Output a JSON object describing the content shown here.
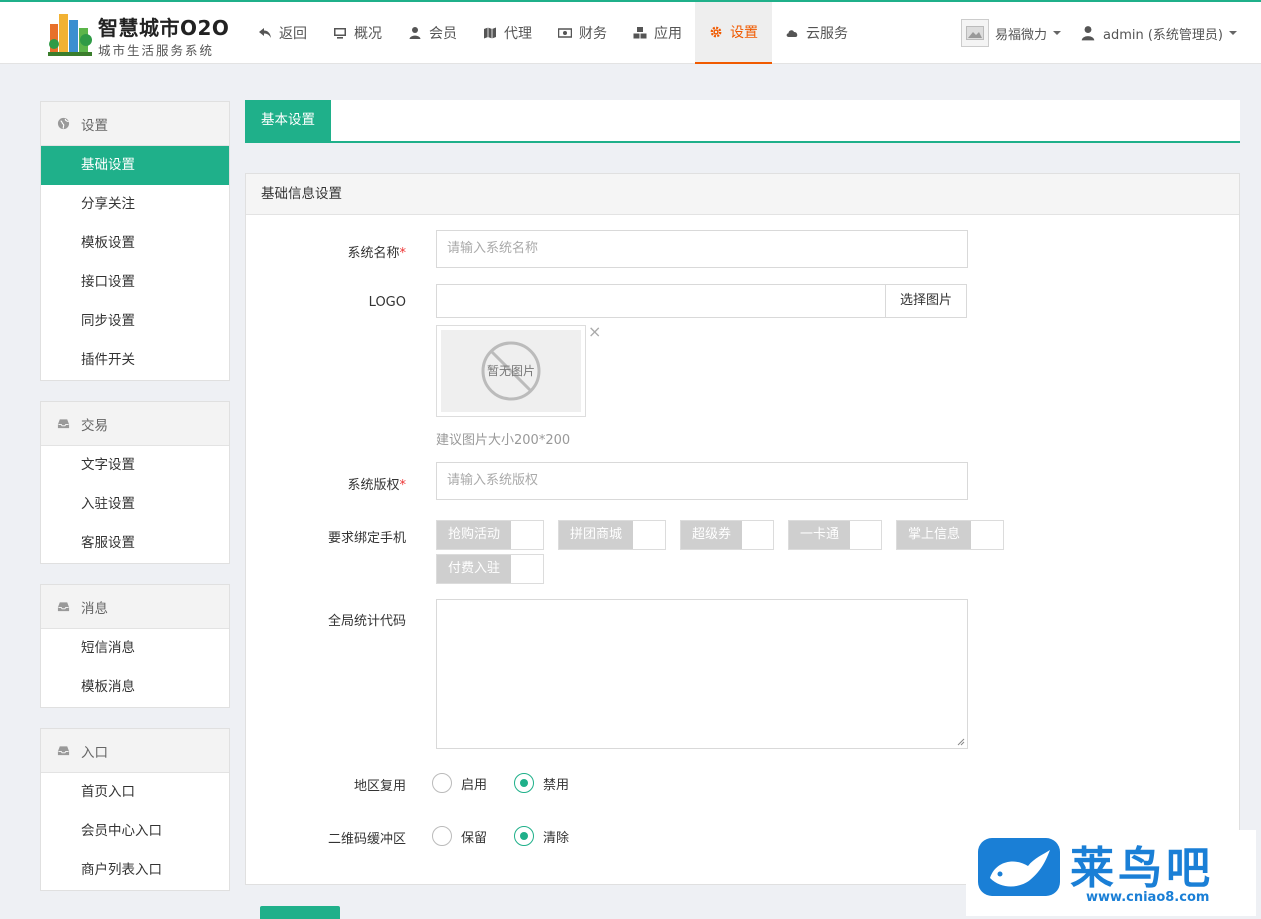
{
  "brand": {
    "title": "智慧城市O2O",
    "subtitle": "城市生活服务系统"
  },
  "nav": [
    {
      "label": "返回",
      "icon": "back-icon"
    },
    {
      "label": "概况",
      "icon": "monitor-icon"
    },
    {
      "label": "会员",
      "icon": "user-icon"
    },
    {
      "label": "代理",
      "icon": "map-icon"
    },
    {
      "label": "财务",
      "icon": "money-icon"
    },
    {
      "label": "应用",
      "icon": "cubes-icon"
    },
    {
      "label": "设置",
      "icon": "gear-icon",
      "active": true
    },
    {
      "label": "云服务",
      "icon": "cloud-icon"
    }
  ],
  "account": {
    "wechat_label": "易福微力",
    "user_label": "admin (系统管理员)"
  },
  "sidebar": [
    {
      "title": "设置",
      "icon": "globe-icon",
      "items": [
        "基础设置",
        "分享关注",
        "模板设置",
        "接口设置",
        "同步设置",
        "插件开关"
      ]
    },
    {
      "title": "交易",
      "icon": "inbox-icon",
      "items": [
        "文字设置",
        "入驻设置",
        "客服设置"
      ]
    },
    {
      "title": "消息",
      "icon": "inbox-icon",
      "items": [
        "短信消息",
        "模板消息"
      ]
    },
    {
      "title": "入口",
      "icon": "inbox-icon",
      "items": [
        "首页入口",
        "会员中心入口",
        "商户列表入口"
      ]
    }
  ],
  "active_sidebar_item": "基础设置",
  "tab": {
    "label": "基本设置"
  },
  "panel": {
    "title": "基础信息设置",
    "system_name": {
      "label": "系统名称",
      "required_mark": "*",
      "placeholder": "请输入系统名称",
      "value": ""
    },
    "logo": {
      "label": "LOGO",
      "value": "",
      "pick_button": "选择图片",
      "no_image_text": "暂无图片",
      "remove_glyph": "×",
      "hint": "建议图片大小200*200"
    },
    "copyright": {
      "label": "系统版权",
      "required_mark": "*",
      "placeholder": "请输入系统版权",
      "value": ""
    },
    "bind_phone": {
      "label": "要求绑定手机",
      "options": [
        "抢购活动",
        "拼团商城",
        "超级券",
        "一卡通",
        "掌上信息",
        "付费入驻"
      ]
    },
    "stat_code": {
      "label": "全局统计代码",
      "value": ""
    },
    "region_reuse": {
      "label": "地区复用",
      "options": [
        "启用",
        "禁用"
      ],
      "selected": "禁用"
    },
    "qr_buffer": {
      "label": "二维码缓冲区",
      "options": [
        "保留",
        "清除"
      ],
      "selected": "清除"
    }
  },
  "watermark": {
    "text": "莱鸟吧",
    "url": "www.cniao8.com"
  },
  "colors": {
    "accent": "#1fb08a",
    "nav_active": "#f05a00",
    "required": "#ee3333"
  }
}
